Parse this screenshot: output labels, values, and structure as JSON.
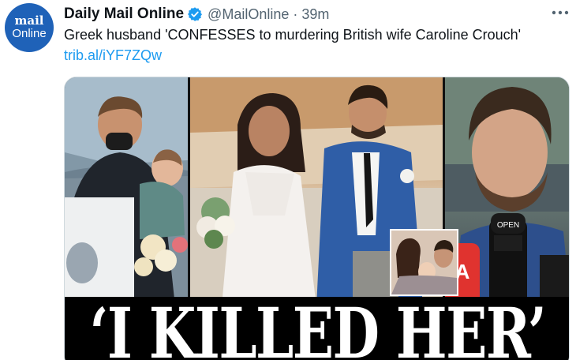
{
  "avatar": {
    "line1": "mail",
    "line2": "Online"
  },
  "tweet": {
    "author_name": "Daily Mail Online",
    "handle": "@MailOnline",
    "separator": "·",
    "time": "39m",
    "text": "Greek husband 'CONFESSES to murdering British wife Caroline Crouch'",
    "link": "trib.al/iYF7ZQw"
  },
  "media": {
    "headline": "‘I KILLED HER’",
    "mic_logo": "OPEN",
    "mic_badge": "A"
  },
  "colors": {
    "link": "#1d9bf0",
    "verified": "#1d9bf0",
    "brand": "#1f62b8",
    "secondary_text": "#536471"
  }
}
